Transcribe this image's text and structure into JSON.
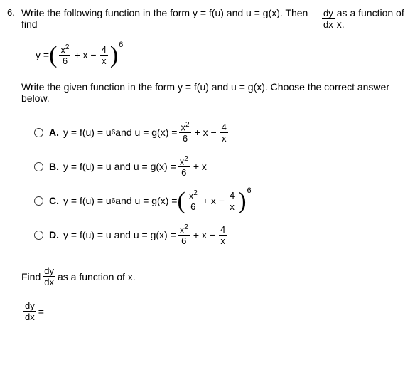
{
  "problem_number": "6.",
  "question": {
    "intro_pre": "Write the following function in the form y = f(u) and u = g(x). Then find ",
    "deriv_num": "dy",
    "deriv_den": "dx",
    "intro_post": " as a function of x."
  },
  "main_eq": {
    "y_eq": "y = ",
    "frac1_num": "x",
    "frac1_num_exp": "2",
    "frac1_den": "6",
    "plus": " + x − ",
    "frac2_num": "4",
    "frac2_den": "x",
    "power": "6"
  },
  "sub_question": "Write the given function in the form y = f(u) and u = g(x). Choose the correct answer below.",
  "options": {
    "A": {
      "label": "A.",
      "text_pre": "y = f(u) = u",
      "pre_exp": "6",
      "text_mid": " and u = g(x) = ",
      "f1n": "x",
      "f1ne": "2",
      "f1d": "6",
      "op1": " + x − ",
      "f2n": "4",
      "f2d": "x"
    },
    "B": {
      "label": "B.",
      "text_pre": "y = f(u) = u and u = g(x) = ",
      "f1n": "x",
      "f1ne": "2",
      "f1d": "6",
      "op1": " + x"
    },
    "C": {
      "label": "C.",
      "text_pre": "y = f(u) = u",
      "pre_exp": "6",
      "text_mid": " and u = g(x) = ",
      "f1n": "x",
      "f1ne": "2",
      "f1d": "6",
      "op1": " + x − ",
      "f2n": "4",
      "f2d": "x",
      "power": "6"
    },
    "D": {
      "label": "D.",
      "text_pre": "y = f(u) = u and u = g(x) = ",
      "f1n": "x",
      "f1ne": "2",
      "f1d": "6",
      "op1": " + x − ",
      "f2n": "4",
      "f2d": "x"
    }
  },
  "find": {
    "pre": "Find ",
    "deriv_num": "dy",
    "deriv_den": "dx",
    "post": " as a function of x."
  },
  "answer": {
    "deriv_num": "dy",
    "deriv_den": "dx",
    "equals": " = "
  }
}
